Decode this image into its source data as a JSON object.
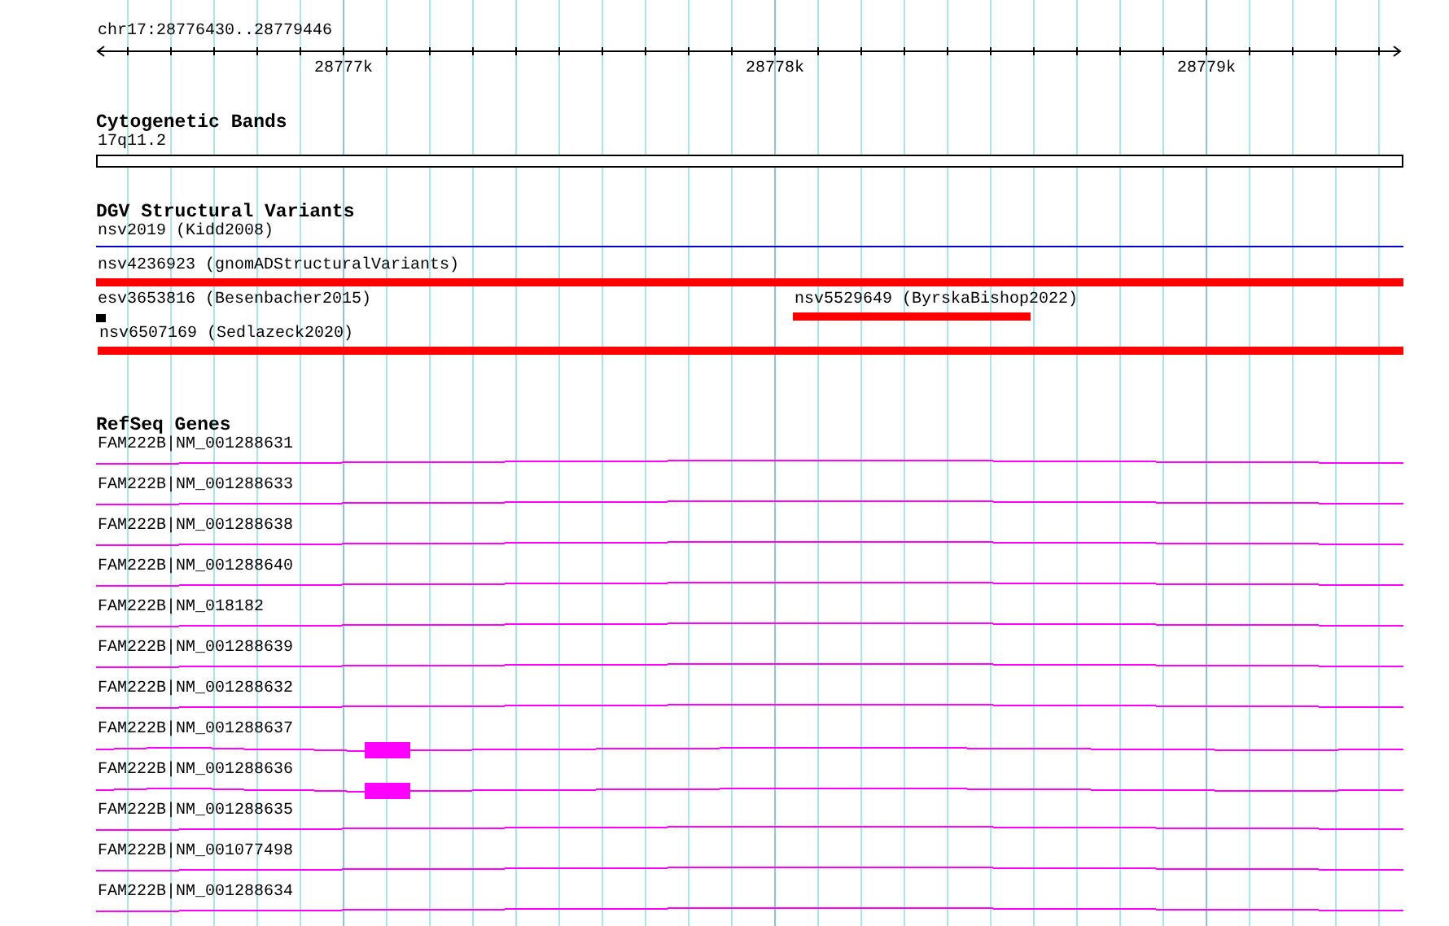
{
  "ruler": {
    "location": "chr17:28776430..28779446",
    "ticks": [
      "28777k",
      "28778k",
      "28779k"
    ]
  },
  "tracks": [
    {
      "kind": "bands",
      "title": "Cytogenetic Bands",
      "features": [
        {
          "label": "17q11.2"
        }
      ]
    },
    {
      "kind": "variants",
      "title": "DGV Structural Variants",
      "features": [
        {
          "label": "nsv2019 (Kidd2008)",
          "color": "#0000cc"
        },
        {
          "label": "nsv4236923 (gnomADStructuralVariants)",
          "color": "#ff0000"
        },
        {
          "label": "esv3653816 (Besenbacher2015)",
          "color": "#000000"
        },
        {
          "label": "nsv5529649 (ByrskaBishop2022)",
          "color": "#ff0000"
        },
        {
          "label": "nsv6507169 (Sedlazeck2020)",
          "color": "#ff0000"
        }
      ]
    },
    {
      "kind": "genes",
      "title": "RefSeq Genes",
      "features": [
        {
          "label": "FAM222B|NM_001288631",
          "coding_exon": false
        },
        {
          "label": "FAM222B|NM_001288633",
          "coding_exon": false
        },
        {
          "label": "FAM222B|NM_001288638",
          "coding_exon": false
        },
        {
          "label": "FAM222B|NM_001288640",
          "coding_exon": false
        },
        {
          "label": "FAM222B|NM_018182",
          "coding_exon": false
        },
        {
          "label": "FAM222B|NM_001288639",
          "coding_exon": false
        },
        {
          "label": "FAM222B|NM_001288632",
          "coding_exon": false
        },
        {
          "label": "FAM222B|NM_001288637",
          "coding_exon": true
        },
        {
          "label": "FAM222B|NM_001288636",
          "coding_exon": true
        },
        {
          "label": "FAM222B|NM_001288635",
          "coding_exon": false
        },
        {
          "label": "FAM222B|NM_001077498",
          "coding_exon": false
        },
        {
          "label": "FAM222B|NM_001288634",
          "coding_exon": false
        }
      ]
    }
  ]
}
